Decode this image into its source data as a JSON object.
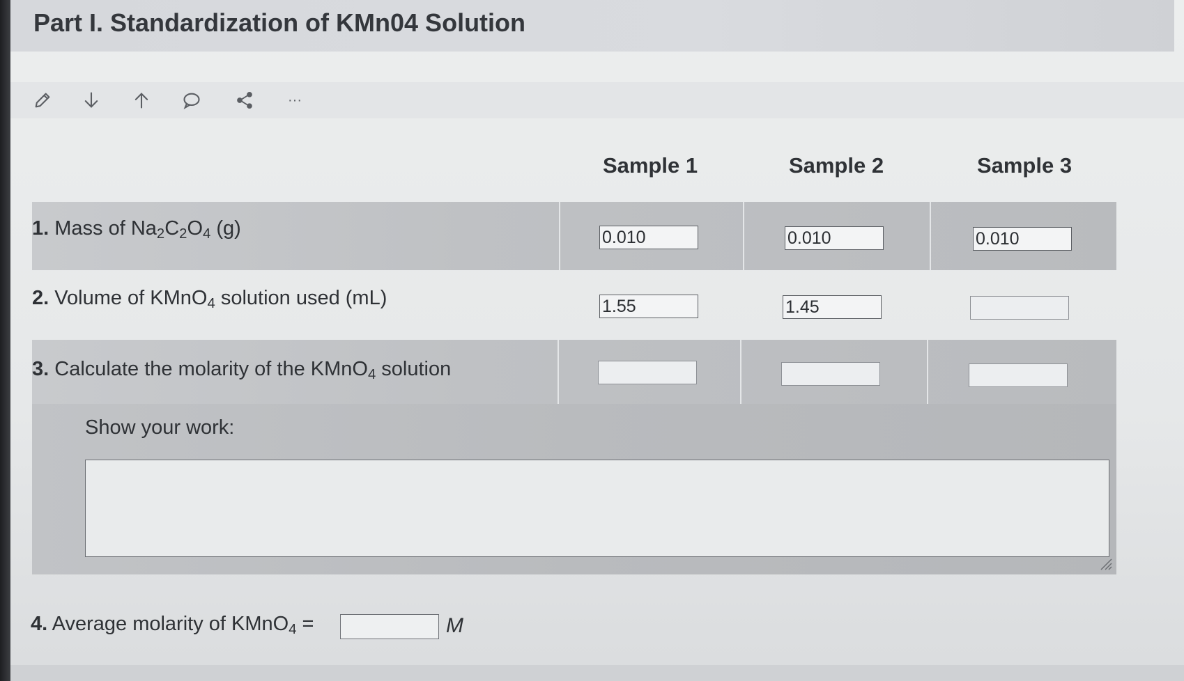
{
  "section": {
    "title": "Part I. Standardization of KMn04 Solution"
  },
  "toolbar": {
    "icons": [
      "pencil-icon",
      "arrow-down-icon",
      "arrow-up-icon",
      "comment-icon",
      "share-icon",
      "more-icon"
    ],
    "more_label": "···"
  },
  "table": {
    "columns": [
      "Sample 1",
      "Sample 2",
      "Sample 3"
    ],
    "row1": {
      "number": "1.",
      "label_pre": "Mass of Na",
      "sub_a": "2",
      "mid_a": "C",
      "sub_b": "2",
      "mid_b": "O",
      "sub_c": "4",
      "label_post": "(g)",
      "values": [
        "0.010",
        "0.010",
        "0.010"
      ]
    },
    "row2": {
      "number": "2.",
      "label_pre": "Volume of KMnO",
      "sub": "4",
      "label_post": "solution used (mL)",
      "values": [
        "1.55",
        "1.45",
        ""
      ]
    },
    "row3": {
      "number": "3.",
      "label_pre": "Calculate the molarity of the KMnO",
      "sub": "4",
      "label_post": "solution",
      "values": [
        "",
        "",
        ""
      ]
    },
    "work": {
      "label": "Show your work:",
      "value": ""
    }
  },
  "average": {
    "number": "4.",
    "label_pre": "Average molarity of KMnO",
    "sub": "4",
    "label_post": "=",
    "value": "",
    "unit": "M"
  }
}
